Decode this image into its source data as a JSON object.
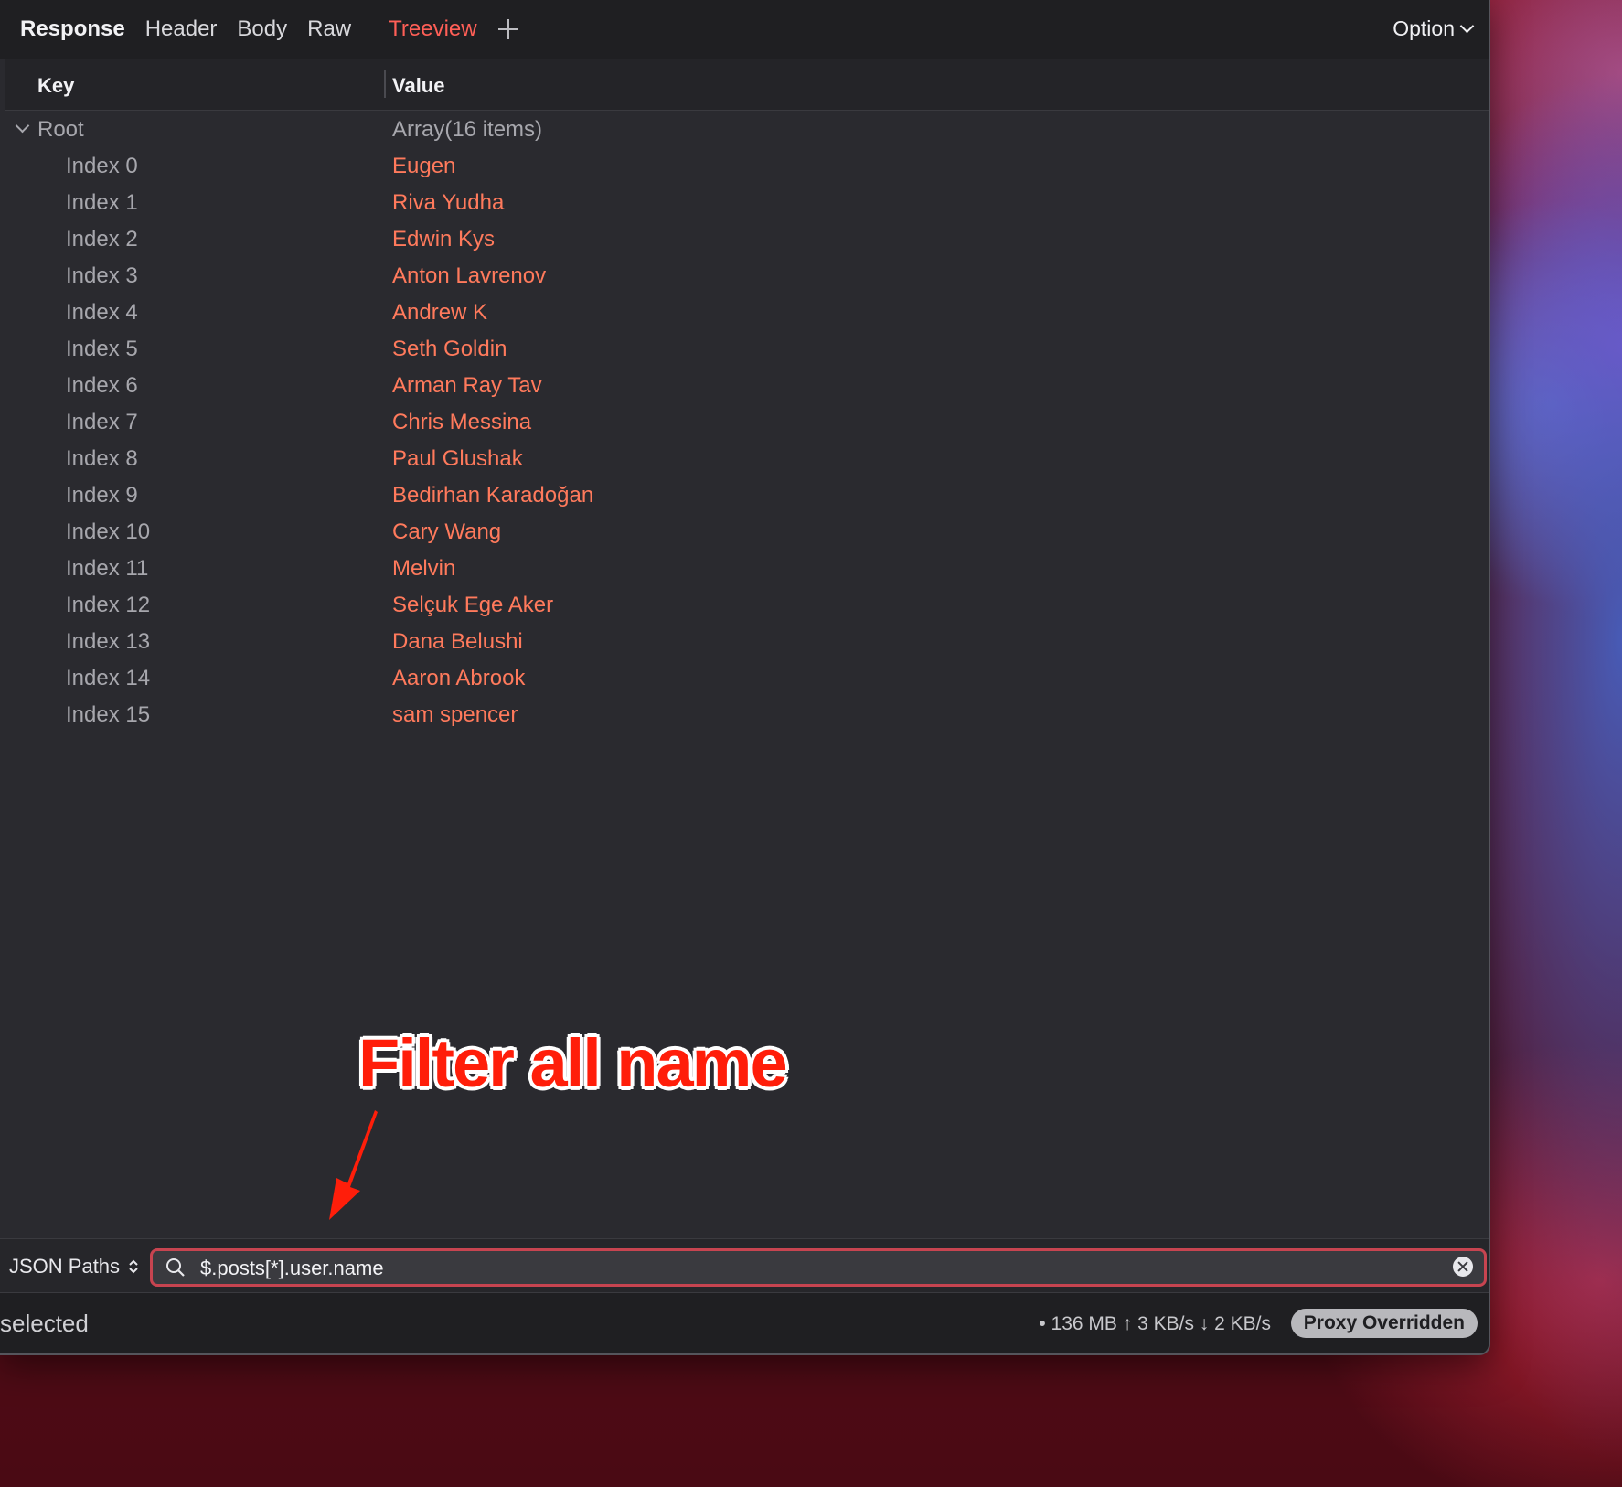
{
  "toolbar": {
    "tabs": [
      "Response",
      "Header",
      "Body",
      "Raw",
      "Treeview"
    ],
    "active_tab": "Treeview",
    "option_label": "Option"
  },
  "columns": {
    "key": "Key",
    "value": "Value"
  },
  "tree": {
    "root": {
      "key": "Root",
      "value": "Array(16 items)"
    },
    "items": [
      {
        "key": "Index 0",
        "value": "Eugen"
      },
      {
        "key": "Index 1",
        "value": "Riva Yudha"
      },
      {
        "key": "Index 2",
        "value": "Edwin Kys"
      },
      {
        "key": "Index 3",
        "value": "Anton Lavrenov"
      },
      {
        "key": "Index 4",
        "value": "Andrew K"
      },
      {
        "key": "Index 5",
        "value": "Seth Goldin"
      },
      {
        "key": "Index 6",
        "value": "Arman Ray Tav"
      },
      {
        "key": "Index 7",
        "value": "Chris Messina"
      },
      {
        "key": "Index 8",
        "value": "Paul Glushak"
      },
      {
        "key": "Index 9",
        "value": "Bedirhan Karadoğan"
      },
      {
        "key": "Index 10",
        "value": "Cary Wang"
      },
      {
        "key": "Index 11",
        "value": "Melvin"
      },
      {
        "key": "Index 12",
        "value": "Selçuk Ege Aker"
      },
      {
        "key": "Index 13",
        "value": "Dana Belushi"
      },
      {
        "key": "Index 14",
        "value": "Aaron Abrook"
      },
      {
        "key": "Index 15",
        "value": "sam spencer"
      }
    ]
  },
  "annotation": {
    "text": "Filter all name",
    "color": "#ff1e0a"
  },
  "filter": {
    "mode_label": "JSON Paths",
    "query": "$.posts[*].user.name"
  },
  "status": {
    "left_text": "selected",
    "stats": "• 136 MB ↑ 3 KB/s ↓ 2 KB/s",
    "badge": "Proxy Overridden"
  },
  "colors": {
    "accent": "#ff5f57",
    "value_text": "#ff7a5c",
    "background": "#2a2a2f"
  }
}
